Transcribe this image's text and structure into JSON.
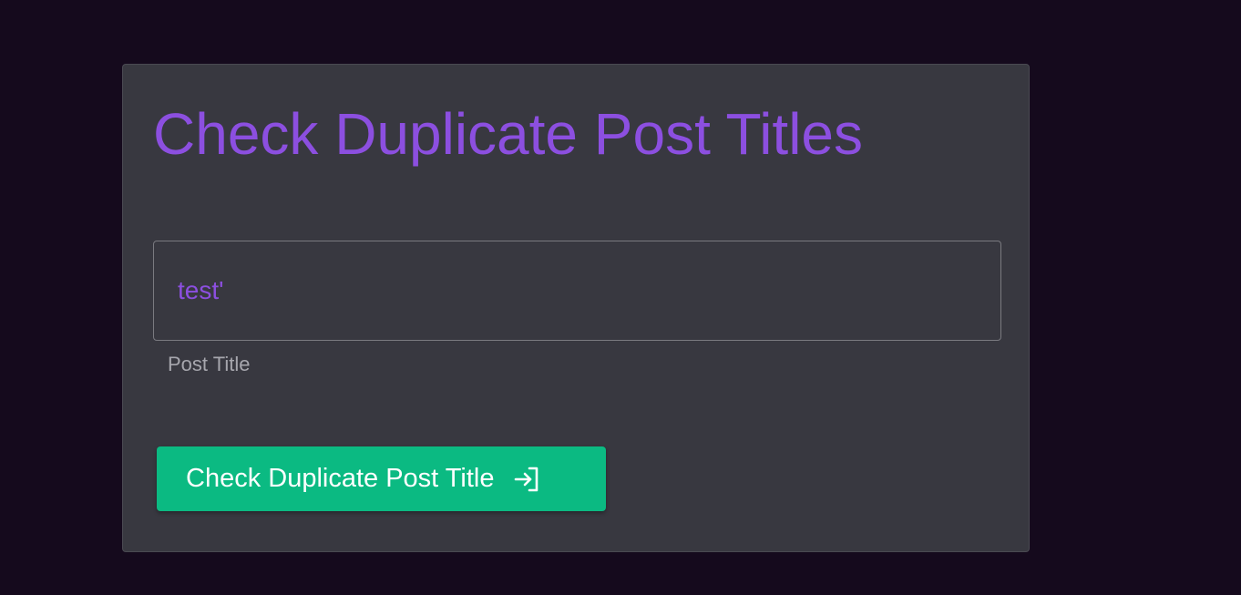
{
  "card": {
    "title": "Check Duplicate Post Titles"
  },
  "form": {
    "post_title_value": "test'",
    "post_title_helper": "Post Title"
  },
  "actions": {
    "submit_label": "Check Duplicate Post Title",
    "submit_icon": "login-arrow-icon"
  },
  "colors": {
    "page_background": "#150a1d",
    "card_background": "#383840",
    "accent_purple": "#8c4fe0",
    "button_green": "#0bba82"
  }
}
